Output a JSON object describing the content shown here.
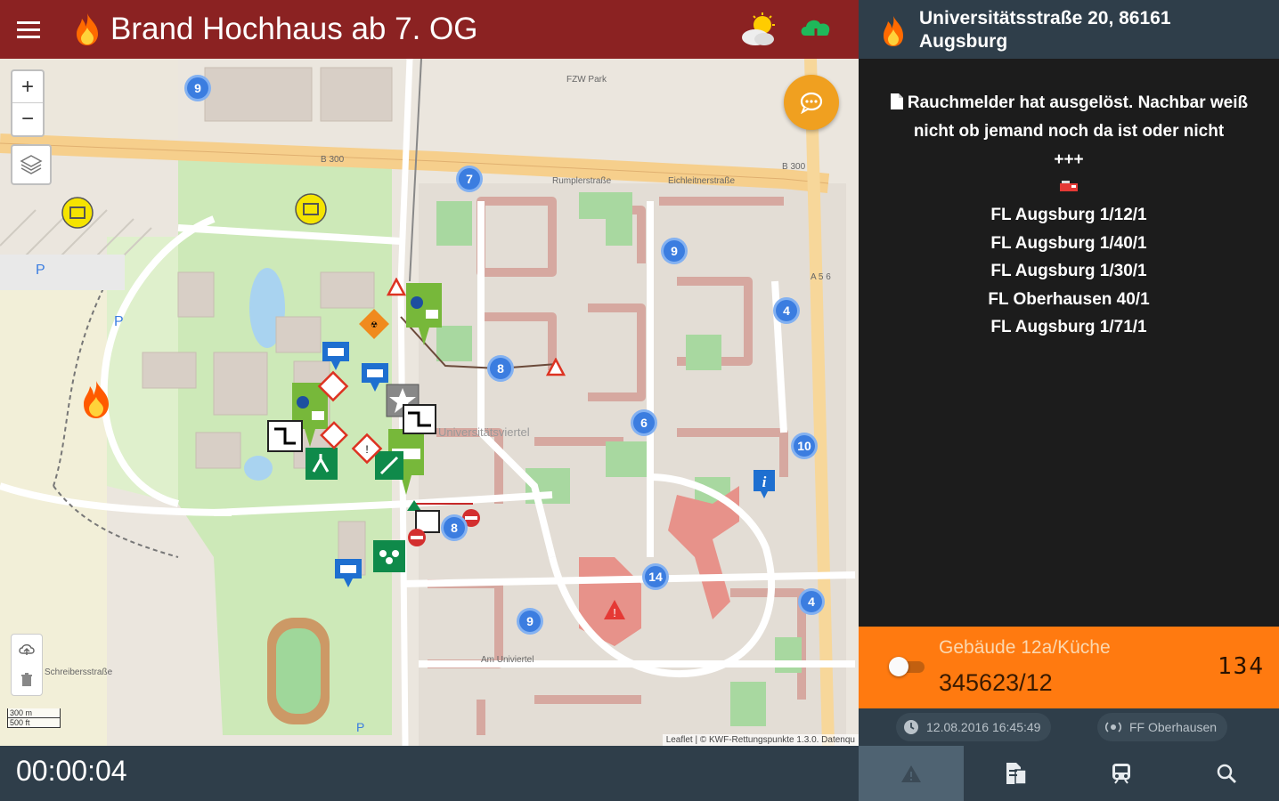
{
  "header": {
    "title": "Brand Hochhaus ab 7. OG",
    "menu_icon": "hamburger-menu-icon",
    "fire_icon": "fire-icon",
    "weather_icon": "sun-cloud-icon",
    "sync_icon": "cloud-sync-icon",
    "color": "#8b2222"
  },
  "map": {
    "zoom_in": "+",
    "zoom_out": "−",
    "street_labels": [
      "B 300",
      "B 300",
      "Rumplerstraße",
      "Eichleitnerstraße",
      "Universitätsviertel",
      "A 5 6",
      "Schreibersstraße",
      "Am Univiertel",
      "FZW Park"
    ],
    "clusters": [
      "9",
      "7",
      "9",
      "4",
      "8",
      "6",
      "10",
      "8",
      "14",
      "9",
      "4"
    ],
    "scale": [
      "300 m",
      "500 ft"
    ],
    "attribution": "Leaflet | © KWF-Rettungspunkte 1.3.0. Datenqu"
  },
  "panel": {
    "address": "Universitätsstraße 20, 86161 Augsburg",
    "message": "Rauchmelder hat ausgelöst. Nachbar weiß nicht ob jemand noch da ist oder nicht",
    "separator": "+++",
    "units": [
      "FL Augsburg 1/12/1",
      "FL Augsburg 1/40/1",
      "FL Augsburg 1/30/1",
      "FL Oberhausen 40/1",
      "FL Augsburg 1/71/1"
    ],
    "location": "Gebäude 12a/Küche",
    "object_number": "345623/12",
    "code": "134",
    "timestamp": "12.08.2016 16:45:49",
    "station": "FF Oberhausen",
    "accent": "#ff7a10"
  },
  "footer": {
    "timer": "00:00:04",
    "tabs": [
      {
        "icon": "warning-icon"
      },
      {
        "icon": "document-icon"
      },
      {
        "icon": "train-icon"
      },
      {
        "icon": "search-icon"
      }
    ]
  }
}
